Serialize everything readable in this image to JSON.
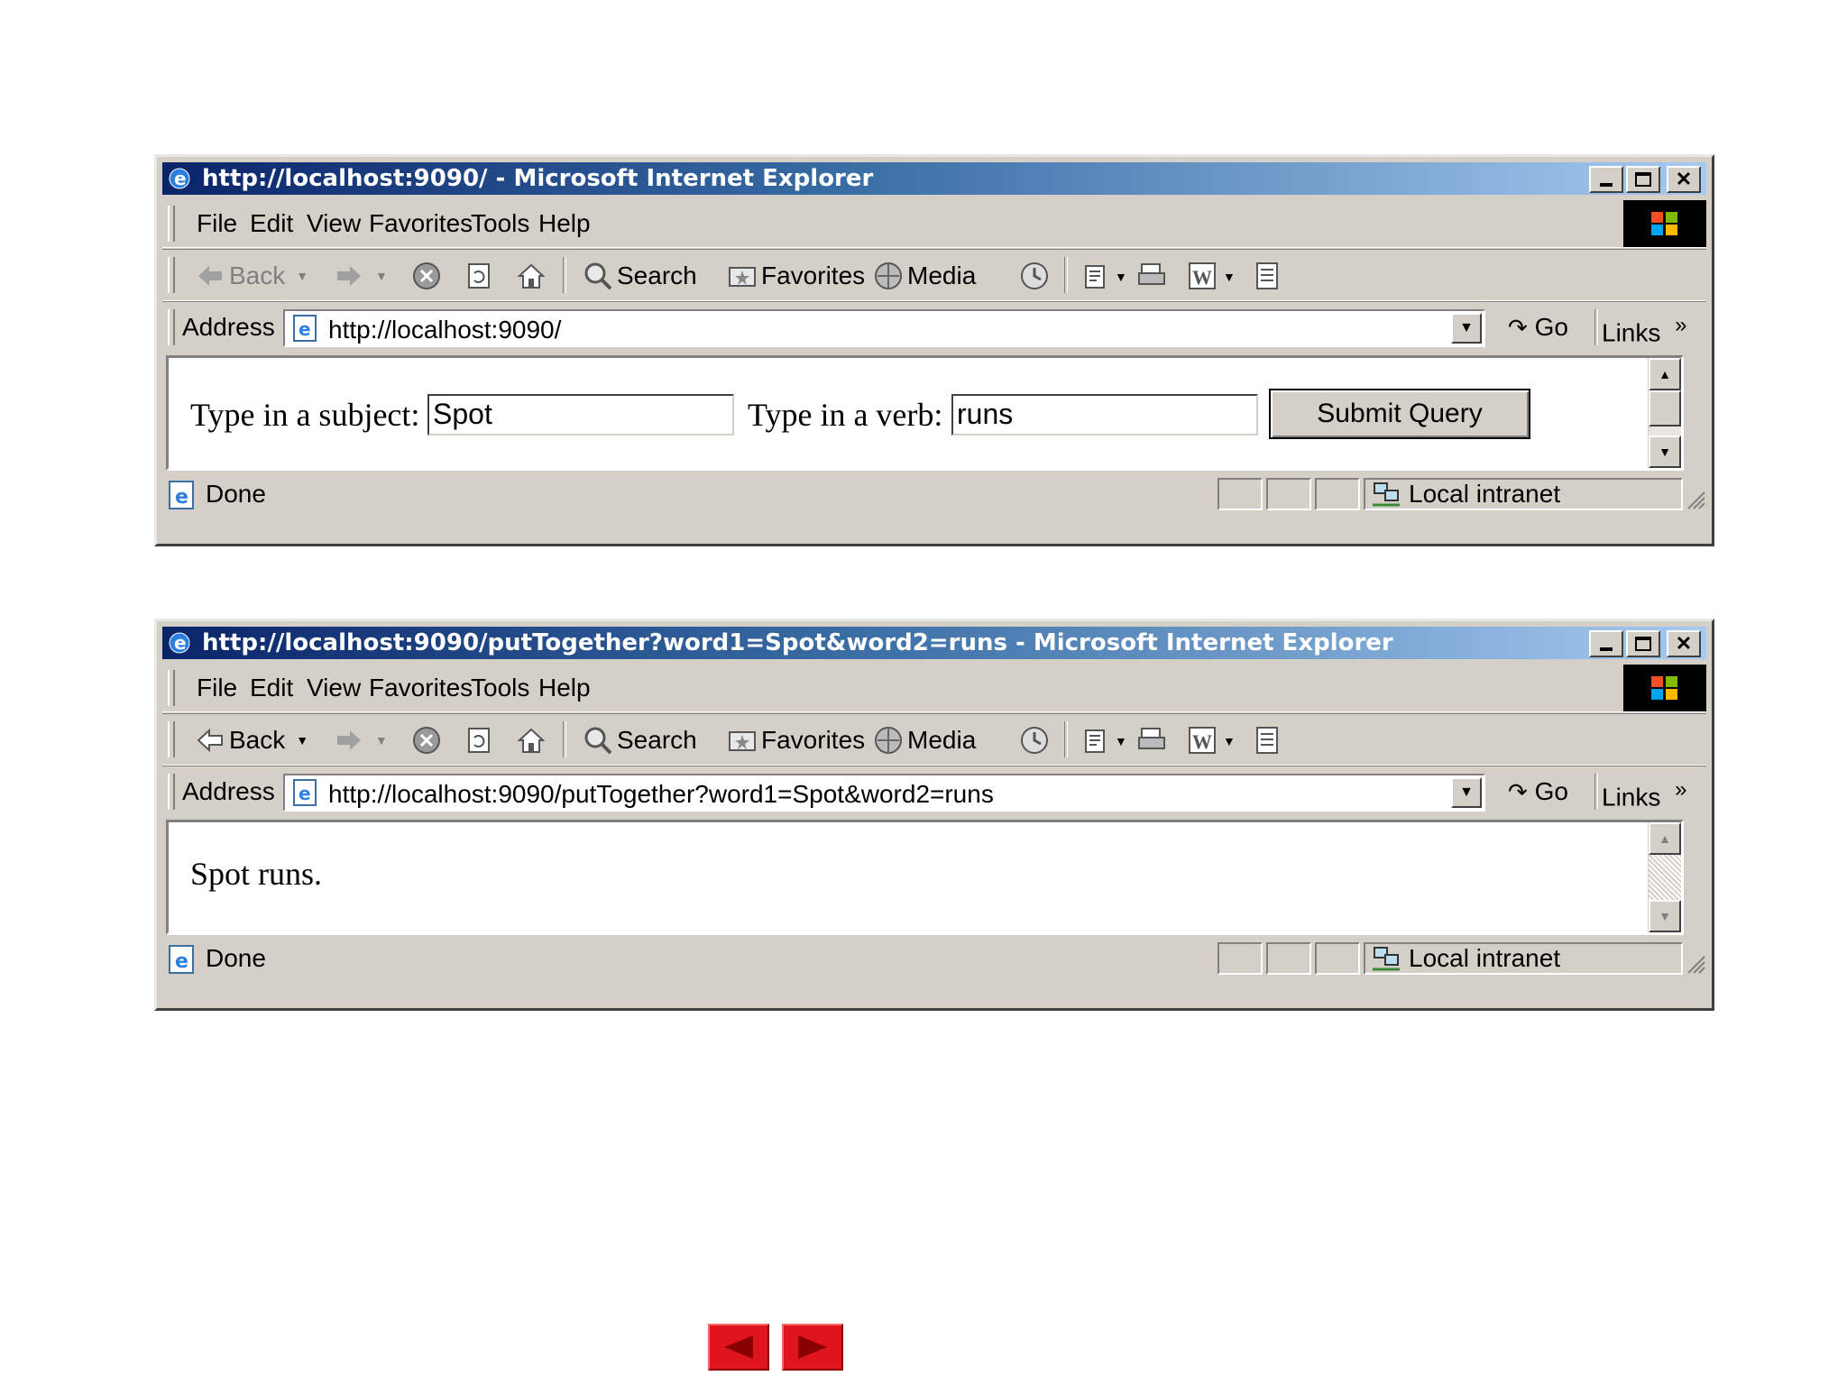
{
  "windows": [
    {
      "title": "http://localhost:9090/ - Microsoft Internet Explorer",
      "address": "http://localhost:9090/",
      "back_enabled": false,
      "page": {
        "subject_label": "Type in a subject:",
        "subject_value": "Spot",
        "verb_label": "Type in a verb:",
        "verb_value": "runs",
        "submit_label": "Submit Query"
      }
    },
    {
      "title": "http://localhost:9090/putTogether?word1=Spot&word2=runs - Microsoft Internet Explorer",
      "address": "http://localhost:9090/putTogether?word1=Spot&word2=runs",
      "back_enabled": true,
      "page": {
        "result_text": "Spot runs."
      }
    }
  ],
  "menu": [
    "File",
    "Edit",
    "View",
    "Favorites",
    "Tools",
    "Help"
  ],
  "toolbar": {
    "back": "Back",
    "search": "Search",
    "favorites": "Favorites",
    "media": "Media"
  },
  "address_label": "Address",
  "go_label": "Go",
  "links_label": "Links",
  "links_chevron": "»",
  "status": {
    "text": "Done",
    "zone": "Local intranet"
  },
  "icons": {
    "minimize": "minimize-icon",
    "maximize": "maximize-icon",
    "close": "close-icon",
    "ie": "ie-icon",
    "nav_prev": "previous-slide-icon",
    "nav_next": "next-slide-icon"
  },
  "colors": {
    "titlebar_start": "#0a246a",
    "titlebar_end": "#a6caf0",
    "chrome": "#d4d0c8",
    "nav_arrow": "#e0141c"
  }
}
